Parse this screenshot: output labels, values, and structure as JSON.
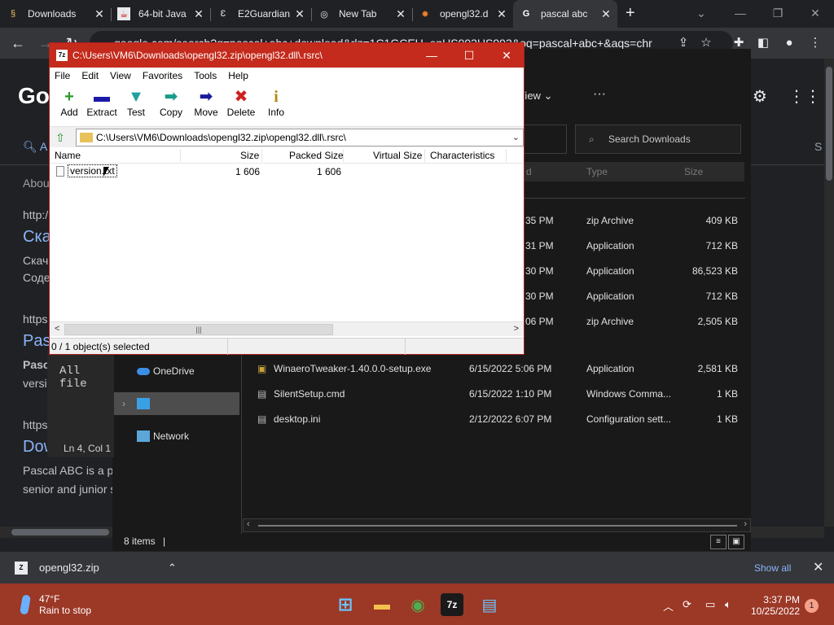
{
  "browser": {
    "tabs": [
      {
        "label": "Downloads"
      },
      {
        "label": "64-bit Java"
      },
      {
        "label": "E2Guardian"
      },
      {
        "label": "New Tab"
      },
      {
        "label": "opengl32.d"
      },
      {
        "label": "pascal abc"
      }
    ],
    "url": "google.com/search?q=pascal+abc+download&rlz=1C1GCEU_enUS993US993&oq=pascal+abc+&aqs=chr"
  },
  "google_page": {
    "logo_fragment": "Go",
    "tab_fragment": "A",
    "about_fragment": "Abou",
    "results": [
      {
        "url_fragment": "http:/",
        "title_fragment": "Скач",
        "snippet": [
          "Скач",
          "Соде"
        ]
      },
      {
        "url_fragment": "https",
        "title_fragment": "Pasc",
        "snippet": [
          "Pasca",
          "versi"
        ]
      },
      {
        "url_fragment": "https",
        "title_fragment": "Dow",
        "snippet": [
          "Pascal ABC is a p",
          "senior and junior s"
        ]
      }
    ]
  },
  "explorer": {
    "view_label": "View",
    "search_placeholder": "Search Downloads",
    "col_headers": {
      "date_fragment": "d",
      "type": "Type",
      "size": "Size"
    },
    "top_rows": [
      {
        "date_fragment": "35 PM",
        "type": "zip Archive",
        "size": "409 KB"
      },
      {
        "date_fragment": "31 PM",
        "type": "Application",
        "size": "712 KB"
      },
      {
        "date_fragment": "30 PM",
        "type": "Application",
        "size": "86,523 KB"
      },
      {
        "date_fragment": "30 PM",
        "type": "Application",
        "size": "712 KB"
      },
      {
        "date_fragment": "06 PM",
        "type": "zip Archive",
        "size": "2,505 KB"
      }
    ],
    "files": [
      {
        "name": "WinaeroTweaker-1.40.0.0-setup.exe",
        "date": "6/15/2022 5:06 PM",
        "type": "Application",
        "size": "2,581 KB"
      },
      {
        "name": "SilentSetup.cmd",
        "date": "6/15/2022 1:10 PM",
        "type": "Windows Comma...",
        "size": "1 KB"
      },
      {
        "name": "desktop.ini",
        "date": "2/12/2022 6:07 PM",
        "type": "Configuration sett...",
        "size": "1 KB"
      }
    ],
    "nav": {
      "onedrive": "OneDrive",
      "network": "Network"
    },
    "status": "8 items"
  },
  "notepad": {
    "text_fragment": "All file",
    "status": "Ln 4, Col 1"
  },
  "sevenzip": {
    "title": "C:\\Users\\VM6\\Downloads\\opengl32.zip\\opengl32.dll\\.rsrc\\",
    "app_icon": "7z",
    "menu": [
      "File",
      "Edit",
      "View",
      "Favorites",
      "Tools",
      "Help"
    ],
    "tools": [
      {
        "label": "Add",
        "glyph": "+",
        "color": "#2a9a2a"
      },
      {
        "label": "Extract",
        "glyph": "▬",
        "color": "#1a1aa8"
      },
      {
        "label": "Test",
        "glyph": "▼",
        "color": "#20a0a0"
      },
      {
        "label": "Copy",
        "glyph": "➡",
        "color": "#1a9a8a"
      },
      {
        "label": "Move",
        "glyph": "➡",
        "color": "#1a1a9a"
      },
      {
        "label": "Delete",
        "glyph": "✖",
        "color": "#d02020"
      },
      {
        "label": "Info",
        "glyph": "i",
        "color": "#b08a10"
      }
    ],
    "path": "C:\\Users\\VM6\\Downloads\\opengl32.zip\\opengl32.dll\\.rsrc\\",
    "columns": {
      "name": "Name",
      "size": "Size",
      "packed": "Packed Size",
      "virtual": "Virtual Size",
      "characteristics": "Characteristics"
    },
    "file": {
      "name": "version.txt",
      "size": "1 606",
      "packed": "1 606"
    },
    "scroll_glyph": "|||",
    "status": "0 / 1 object(s) selected"
  },
  "downloads_bar": {
    "file": "opengl32.zip",
    "show_all": "Show all"
  },
  "taskbar": {
    "temp": "47°F",
    "weather": "Rain to stop",
    "time": "3:37 PM",
    "date": "10/25/2022",
    "notifications": "1",
    "apps": [
      {
        "name": "start",
        "glyph": "⊞"
      },
      {
        "name": "file-explorer",
        "glyph": "▬"
      },
      {
        "name": "chrome",
        "glyph": "◉"
      },
      {
        "name": "7zip",
        "glyph": "7z"
      },
      {
        "name": "notepad",
        "glyph": "▤"
      }
    ]
  }
}
